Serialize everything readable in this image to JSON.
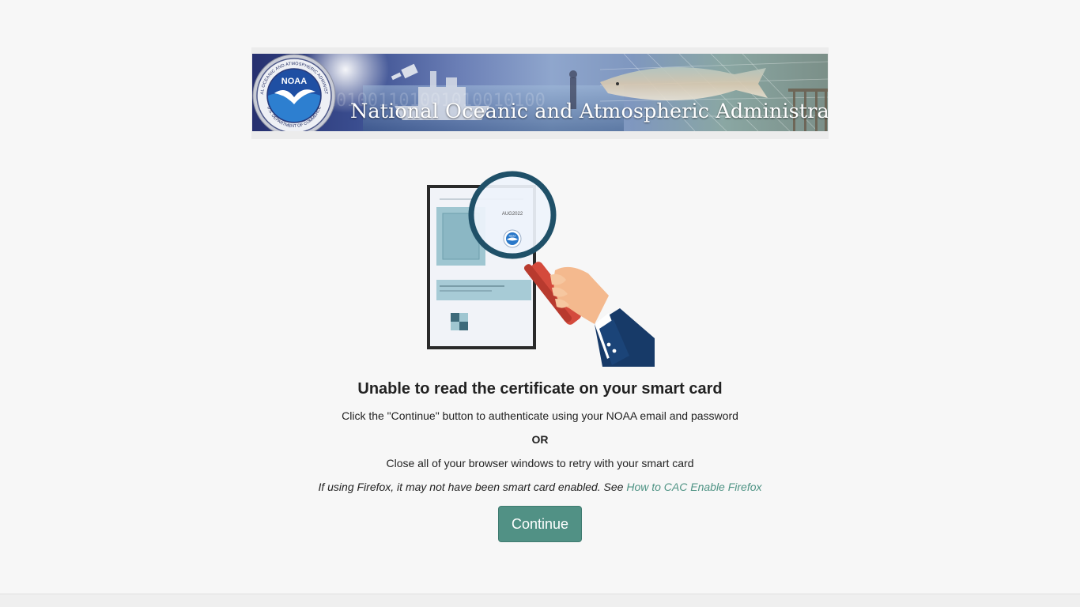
{
  "banner": {
    "title": "National Oceanic and Atmospheric Administration",
    "seal_center_text": "NOAA",
    "seal_ring_text_top": "NATIONAL OCEANIC AND ATMOSPHERIC ADMINISTRATION",
    "seal_ring_text_bottom": "U.S. DEPARTMENT OF COMMERCE",
    "binary_text": "0010010101001101001010010100"
  },
  "illustration": {
    "card_date": "AUG2022",
    "logo_text": "NOAA"
  },
  "message": {
    "heading": "Unable to read the certificate on your smart card",
    "line1": "Click the \"Continue\" button to authenticate using your NOAA email and password",
    "or": "OR",
    "line2": "Close all of your browser windows to retry with your smart card",
    "firefox_prefix": "If using Firefox, it may not have been smart card enabled. See ",
    "firefox_link": "How to CAC Enable Firefox"
  },
  "actions": {
    "continue_label": "Continue"
  },
  "colors": {
    "accent": "#519185",
    "link": "#4e9384",
    "page_bg": "#f7f7f7"
  }
}
